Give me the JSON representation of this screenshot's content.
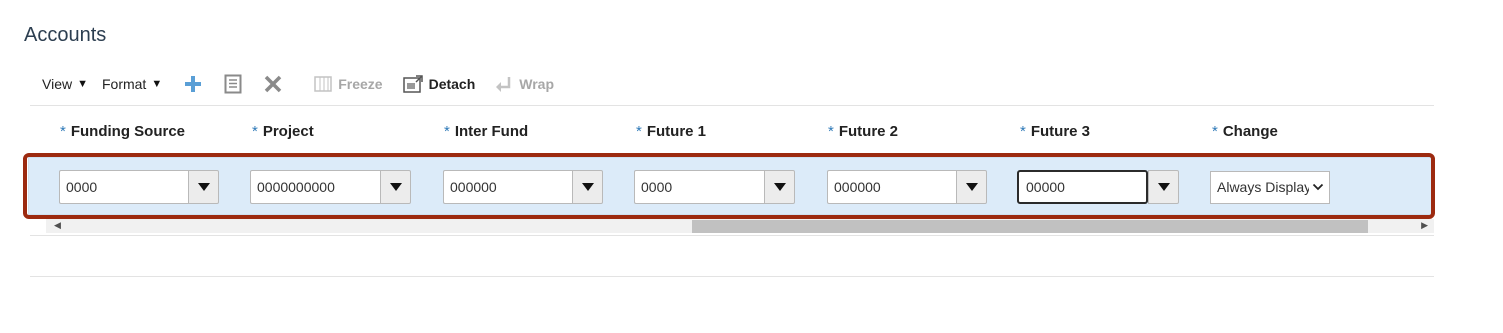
{
  "title": "Accounts",
  "toolbar": {
    "view_label": "View",
    "format_label": "Format",
    "freeze_label": "Freeze",
    "detach_label": "Detach",
    "wrap_label": "Wrap",
    "caret_glyph": "▼"
  },
  "required_marker": "*",
  "columns": [
    {
      "label": "Funding Source",
      "value": "0000"
    },
    {
      "label": "Project",
      "value": "0000000000"
    },
    {
      "label": "Inter Fund",
      "value": "000000"
    },
    {
      "label": "Future 1",
      "value": "0000"
    },
    {
      "label": "Future 2",
      "value": "000000"
    },
    {
      "label": "Future 3",
      "value": "00000"
    },
    {
      "label": "Change",
      "value": "Always Display"
    }
  ],
  "colors": {
    "accent_blue": "#2f7ab8",
    "row_selected": "#dcebf9",
    "highlight_border": "#9c2a10"
  }
}
